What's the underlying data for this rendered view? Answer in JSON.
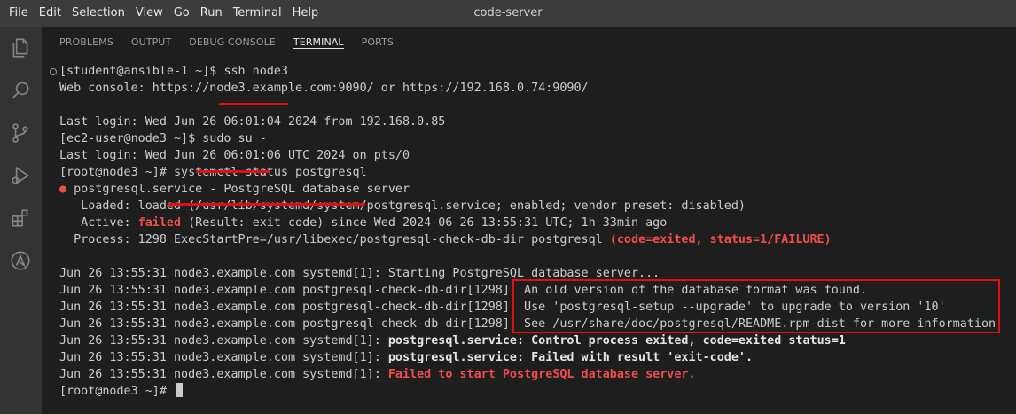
{
  "window": {
    "title": "code-server"
  },
  "menu": [
    "File",
    "Edit",
    "Selection",
    "View",
    "Go",
    "Run",
    "Terminal",
    "Help"
  ],
  "activity_bar": [
    {
      "name": "explorer-icon"
    },
    {
      "name": "search-icon"
    },
    {
      "name": "source-control-icon"
    },
    {
      "name": "run-debug-icon"
    },
    {
      "name": "extensions-icon"
    },
    {
      "name": "ansible-icon"
    }
  ],
  "panel_tabs": [
    "PROBLEMS",
    "OUTPUT",
    "DEBUG CONSOLE",
    "TERMINAL",
    "PORTS"
  ],
  "active_tab": "TERMINAL",
  "colors": {
    "error_red": "#f14c4c",
    "annotation_red": "#e01010"
  },
  "terminal": {
    "l1_prompt": "[student@ansible-1 ~]$ ",
    "l1_cmd": "ssh node3",
    "l2": "Web console: https://node3.example.com:9090/ or https://192.168.0.74:9090/",
    "l4": "Last login: Wed Jun 26 06:01:04 2024 from 192.168.0.85",
    "l5_prompt": "[ec2-user@node3 ~]$ ",
    "l5_cmd": "sudo su -",
    "l6": "Last login: Wed Jun 26 06:01:06 UTC 2024 on pts/0",
    "l7_prompt": "[root@node3 ~]# ",
    "l7_cmd": "systemctl status postgresql",
    "l8_bullet": "●",
    "l8": "postgresql.service - PostgreSQL database server",
    "l9": "   Loaded: loaded (/usr/lib/systemd/system/postgresql.service; enabled; vendor preset: disabled)",
    "l10_a": "   Active: ",
    "l10_b": "failed",
    "l10_c": " (Result: exit-code) since Wed 2024-06-26 13:55:31 UTC; 1h 33min ago",
    "l11_a": "  Process: 1298 ExecStartPre=/usr/libexec/postgresql-check-db-dir postgresql ",
    "l11_b": "(code=exited, status=1/FAILURE)",
    "l13": "Jun 26 13:55:31 node3.example.com systemd[1]: Starting PostgreSQL database server...",
    "l14_a": "Jun 26 13:55:31 node3.example.com postgresql-check-db-dir[1298]: ",
    "l14_b": "An old version of the database format was found.",
    "l15_a": "Jun 26 13:55:31 node3.example.com postgresql-check-db-dir[1298]: ",
    "l15_b": "Use 'postgresql-setup --upgrade' to upgrade to version '10'",
    "l16_a": "Jun 26 13:55:31 node3.example.com postgresql-check-db-dir[1298]: ",
    "l16_b": "See /usr/share/doc/postgresql/README.rpm-dist for more information.",
    "l17_a": "Jun 26 13:55:31 node3.example.com systemd[1]: ",
    "l17_b": "postgresql.service: Control process exited, code=exited status=1",
    "l18_a": "Jun 26 13:55:31 node3.example.com systemd[1]: ",
    "l18_b": "postgresql.service: Failed with result 'exit-code'.",
    "l19_a": "Jun 26 13:55:31 node3.example.com systemd[1]: ",
    "l19_b": "Failed to start PostgreSQL database server.",
    "l20_prompt": "[root@node3 ~]# "
  }
}
